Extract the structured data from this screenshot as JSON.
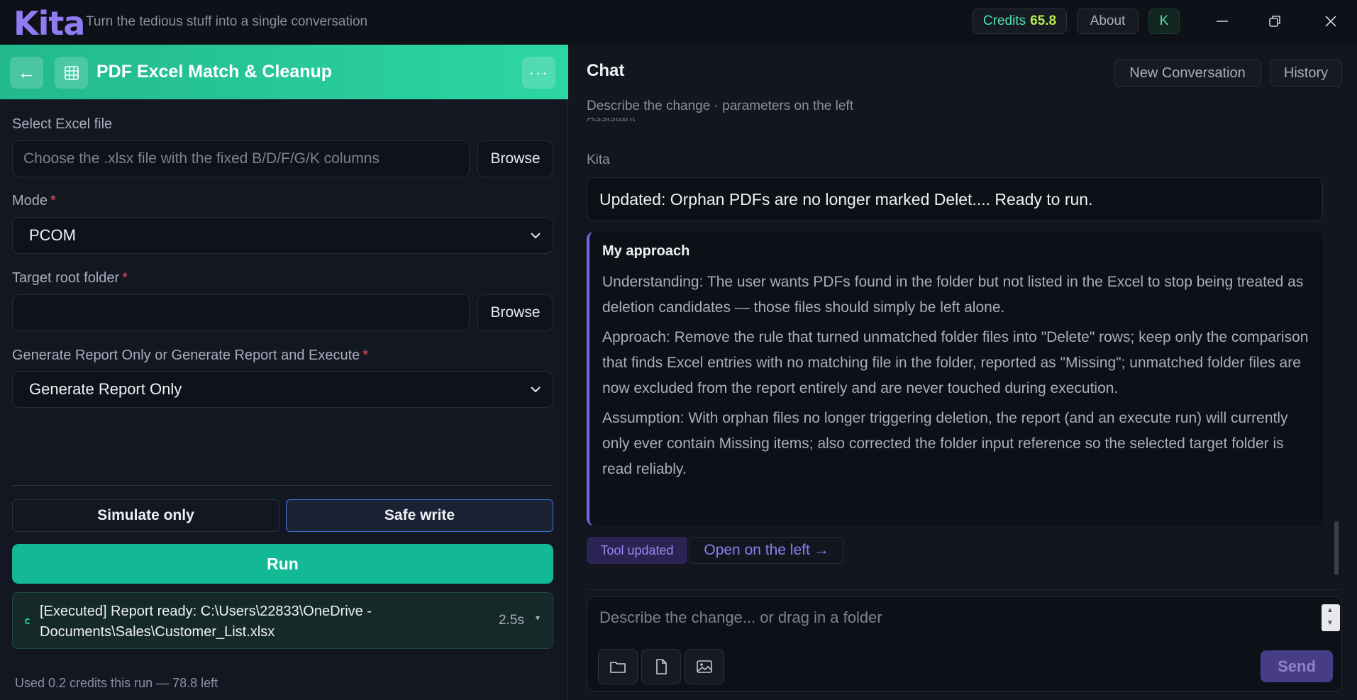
{
  "app": {
    "logo": "Kita",
    "tagline": "Turn the tedious stuff into a single conversation",
    "credits_label": "Credits",
    "credits_value": "65.8",
    "about_label": "About",
    "avatar_initial": "K"
  },
  "tool": {
    "back_glyph": "←",
    "name": "PDF Excel Match & Cleanup",
    "menu_glyph": "···"
  },
  "form": {
    "excel_label": "Select Excel file",
    "excel_placeholder": "Choose the .xlsx file with the fixed B/D/F/G/K columns",
    "browse_label": "Browse",
    "mode_label": "Mode",
    "mode_value": "PCOM",
    "target_label": "Target root folder",
    "target_value": "",
    "gen_label": "Generate Report Only or Generate Report and Execute",
    "gen_value": "Generate Report Only",
    "required_mark": "*"
  },
  "run": {
    "simulate_label": "Simulate only",
    "safe_label": "Safe write",
    "run_label": "Run",
    "status_message": "[Executed] Report ready: C:\\Users\\22833\\OneDrive - Documents\\Sales\\Customer_List.xlsx",
    "status_time": "2.5s",
    "usage": "Used 0.2 credits this run — 78.8 left"
  },
  "chat": {
    "title": "Chat",
    "subtitle": "Describe the change · parameters on the left",
    "new_conversation": "New Conversation",
    "history": "History",
    "cut_off_text": "Assistant",
    "sender": "Kita",
    "reply": "Updated: Orphan PDFs are no longer marked Delet.... Ready to run.",
    "approach_heading": "My approach",
    "approach_paragraphs": [
      "Understanding: The user wants PDFs found in the folder but not listed in the Excel to stop being treated as deletion candidates — those files should simply be left alone.",
      "Approach: Remove the rule that turned unmatched folder files into \"Delete\" rows; keep only the comparison that finds Excel entries with no matching file in the folder, reported as \"Missing\"; unmatched folder files are now excluded from the report entirely and are never touched during execution.",
      "Assumption: With orphan files no longer triggering deletion, the report (and an execute run) will currently only ever contain Missing items; also corrected the folder input reference so the selected target folder is read reliably."
    ],
    "tool_updated": "Tool updated",
    "open_left": "Open on the left →",
    "composer_placeholder": "Describe the change... or drag in a folder",
    "send_label": "Send"
  },
  "icons": {
    "grid": "table-grid-icon",
    "folder": "folder-icon",
    "file": "file-icon",
    "image": "image-icon"
  },
  "colors": {
    "accent": "#8f7cf2",
    "header_green": "#2ed6a2",
    "run_green": "#13b994",
    "credits": "#4fe0b2"
  }
}
